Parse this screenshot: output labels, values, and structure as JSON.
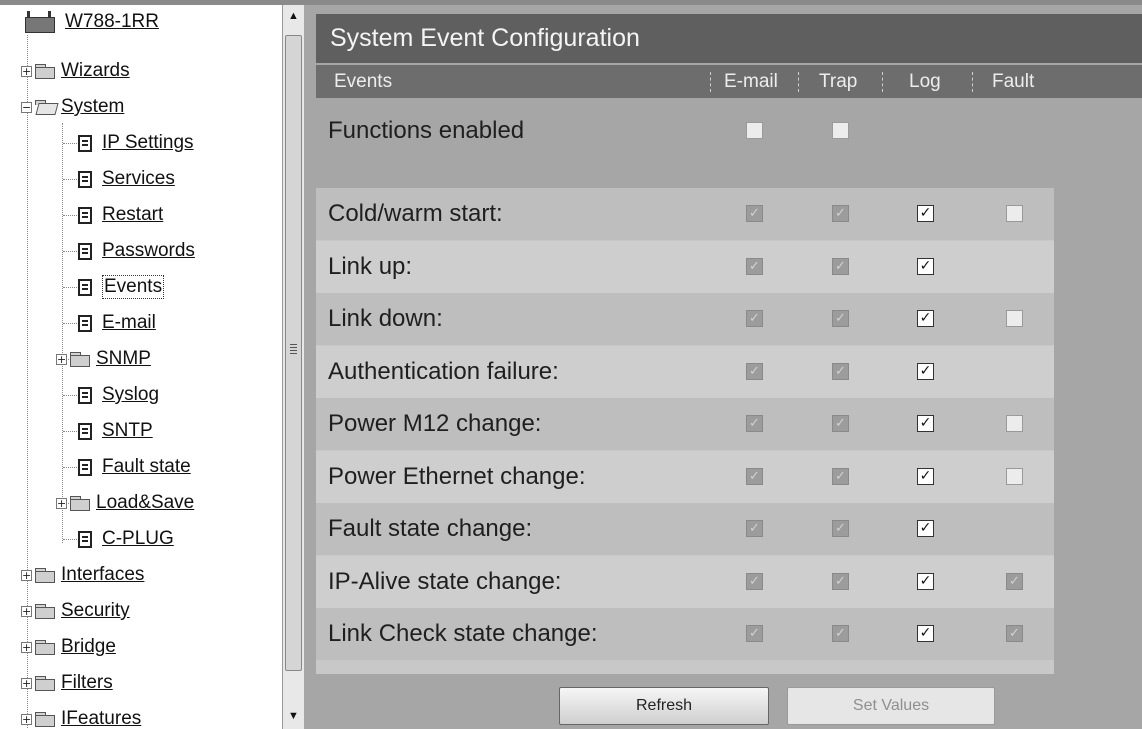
{
  "tree": {
    "root_label": "W788-1RR",
    "items": [
      {
        "label": "Wizards",
        "kind": "folder",
        "expander": "+",
        "level": 0
      },
      {
        "label": "System",
        "kind": "folder-open",
        "expander": "−",
        "level": 0
      },
      {
        "label": "IP Settings",
        "kind": "page",
        "level": 1
      },
      {
        "label": "Services",
        "kind": "page",
        "level": 1
      },
      {
        "label": "Restart",
        "kind": "page",
        "level": 1
      },
      {
        "label": "Passwords",
        "kind": "page",
        "level": 1
      },
      {
        "label": "Events",
        "kind": "page",
        "level": 1,
        "current": true
      },
      {
        "label": "E-mail",
        "kind": "page",
        "level": 1
      },
      {
        "label": "SNMP",
        "kind": "folder",
        "expander": "+",
        "level": 1
      },
      {
        "label": "Syslog",
        "kind": "page",
        "level": 1
      },
      {
        "label": "SNTP",
        "kind": "page",
        "level": 1
      },
      {
        "label": "Fault state",
        "kind": "page",
        "level": 1
      },
      {
        "label": "Load&Save",
        "kind": "folder",
        "expander": "+",
        "level": 1
      },
      {
        "label": "C-PLUG",
        "kind": "page",
        "level": 1
      },
      {
        "label": "Interfaces",
        "kind": "folder",
        "expander": "+",
        "level": 0
      },
      {
        "label": "Security",
        "kind": "folder",
        "expander": "+",
        "level": 0
      },
      {
        "label": "Bridge",
        "kind": "folder",
        "expander": "+",
        "level": 0
      },
      {
        "label": "Filters",
        "kind": "folder",
        "expander": "+",
        "level": 0
      },
      {
        "label": "IFeatures",
        "kind": "folder",
        "expander": "+",
        "level": 0
      }
    ]
  },
  "scrollbar": {
    "up_arrow": "▲",
    "down_arrow": "▼"
  },
  "panel": {
    "title": "System Event Configuration",
    "columns": {
      "events": "Events",
      "email": "E-mail",
      "trap": "Trap",
      "log": "Log",
      "fault": "Fault"
    },
    "functions_enabled": {
      "label": "Functions enabled",
      "email": "empty",
      "trap": "empty"
    },
    "rows": [
      {
        "label": "Cold/warm start:",
        "email": "disabled",
        "trap": "disabled",
        "log": "checked",
        "fault": "empty"
      },
      {
        "label": "Link up:",
        "email": "disabled",
        "trap": "disabled",
        "log": "checked",
        "fault": "none"
      },
      {
        "label": "Link down:",
        "email": "disabled",
        "trap": "disabled",
        "log": "checked",
        "fault": "empty"
      },
      {
        "label": "Authentication failure:",
        "email": "disabled",
        "trap": "disabled",
        "log": "checked",
        "fault": "none"
      },
      {
        "label": "Power M12 change:",
        "email": "disabled",
        "trap": "disabled",
        "log": "checked",
        "fault": "empty"
      },
      {
        "label": "Power Ethernet change:",
        "email": "disabled",
        "trap": "disabled",
        "log": "checked",
        "fault": "empty"
      },
      {
        "label": "Fault state change:",
        "email": "disabled",
        "trap": "disabled",
        "log": "checked",
        "fault": "none"
      },
      {
        "label": "IP-Alive state change:",
        "email": "disabled",
        "trap": "disabled",
        "log": "checked",
        "fault": "disabled"
      },
      {
        "label": "Link Check state change:",
        "email": "disabled",
        "trap": "disabled",
        "log": "checked",
        "fault": "disabled"
      }
    ],
    "buttons": {
      "refresh": "Refresh",
      "set_values": "Set Values"
    }
  }
}
